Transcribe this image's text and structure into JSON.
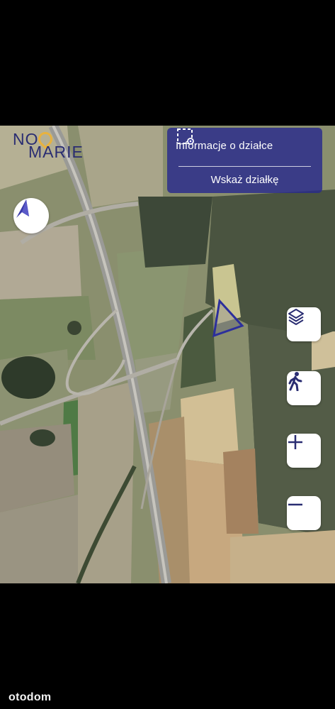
{
  "brand": {
    "logo_line1": "NO",
    "logo_line2": "MARIE",
    "logo_colors": {
      "text": "#2a2d72",
      "pin": "#e8b23e"
    }
  },
  "info_panel": {
    "title": "Informacje o działce",
    "title_icon": "parcel-location-icon",
    "action": "Wskaż działkę",
    "background": "#282a8c"
  },
  "map_controls": [
    {
      "name": "layers",
      "icon": "layers-icon"
    },
    {
      "name": "walk",
      "icon": "pedestrian-icon"
    },
    {
      "name": "zoom-in",
      "icon": "plus-icon"
    },
    {
      "name": "zoom-out",
      "icon": "minus-icon"
    }
  ],
  "compass": {
    "icon": "navigation-arrow-icon",
    "color": "#3a3aa8"
  },
  "parcel_marker": {
    "shape": "triangle",
    "stroke": "#2c2f9c"
  },
  "map": {
    "type": "satellite"
  },
  "watermark": "otodom",
  "colors": {
    "accent": "#2a2d8c"
  }
}
